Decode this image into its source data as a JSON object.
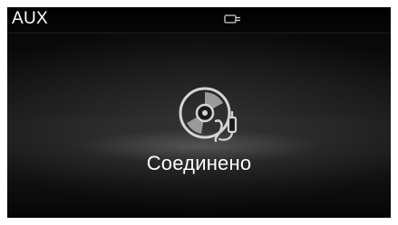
{
  "header": {
    "title": "AUX",
    "status_icon": "plug-icon"
  },
  "main": {
    "icon": "aux-disc-icon",
    "status_message": "Соединено"
  },
  "colors": {
    "text": "#ffffff",
    "background": "#141414",
    "icon": "#d0d0d0"
  }
}
